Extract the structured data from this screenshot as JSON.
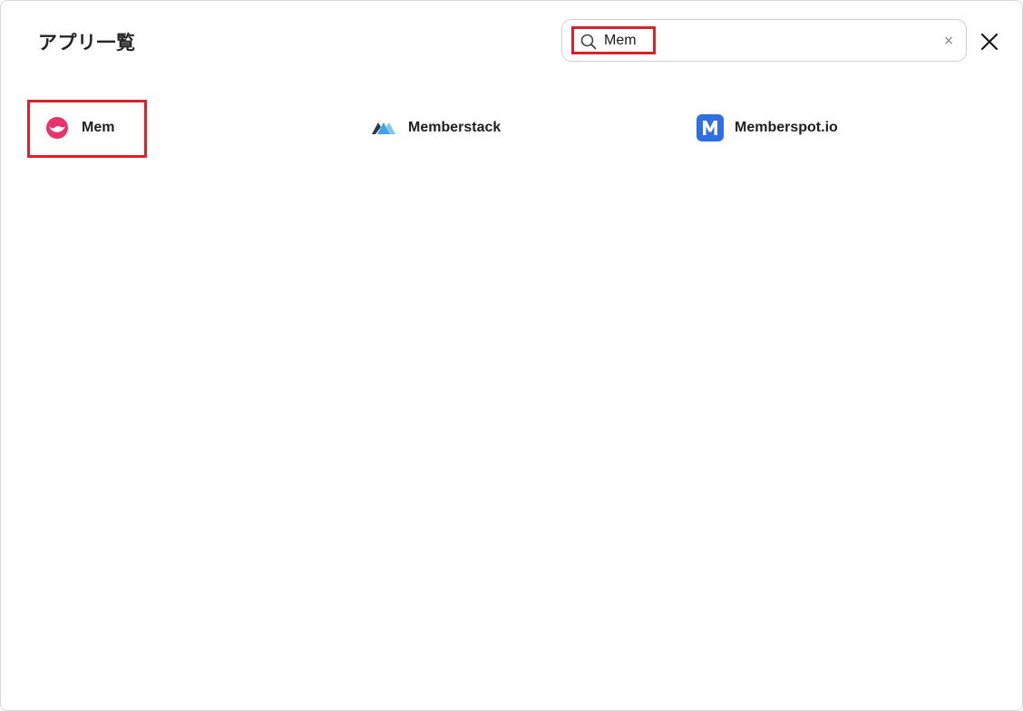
{
  "dialog": {
    "title": "アプリ一覧"
  },
  "search": {
    "value": "Mem",
    "icon": "search-icon",
    "clear_glyph": "×"
  },
  "close": {
    "icon": "close-icon"
  },
  "apps": [
    {
      "label": "Mem",
      "icon": "mem-logo-icon",
      "color": "#e8336c"
    },
    {
      "label": "Memberstack",
      "icon": "memberstack-logo-icon",
      "color": "#2a3a4a"
    },
    {
      "label": "Memberspot.io",
      "icon": "memberspot-logo-icon",
      "color": "#2f6fe4"
    }
  ],
  "highlight_color": "#d8232a"
}
